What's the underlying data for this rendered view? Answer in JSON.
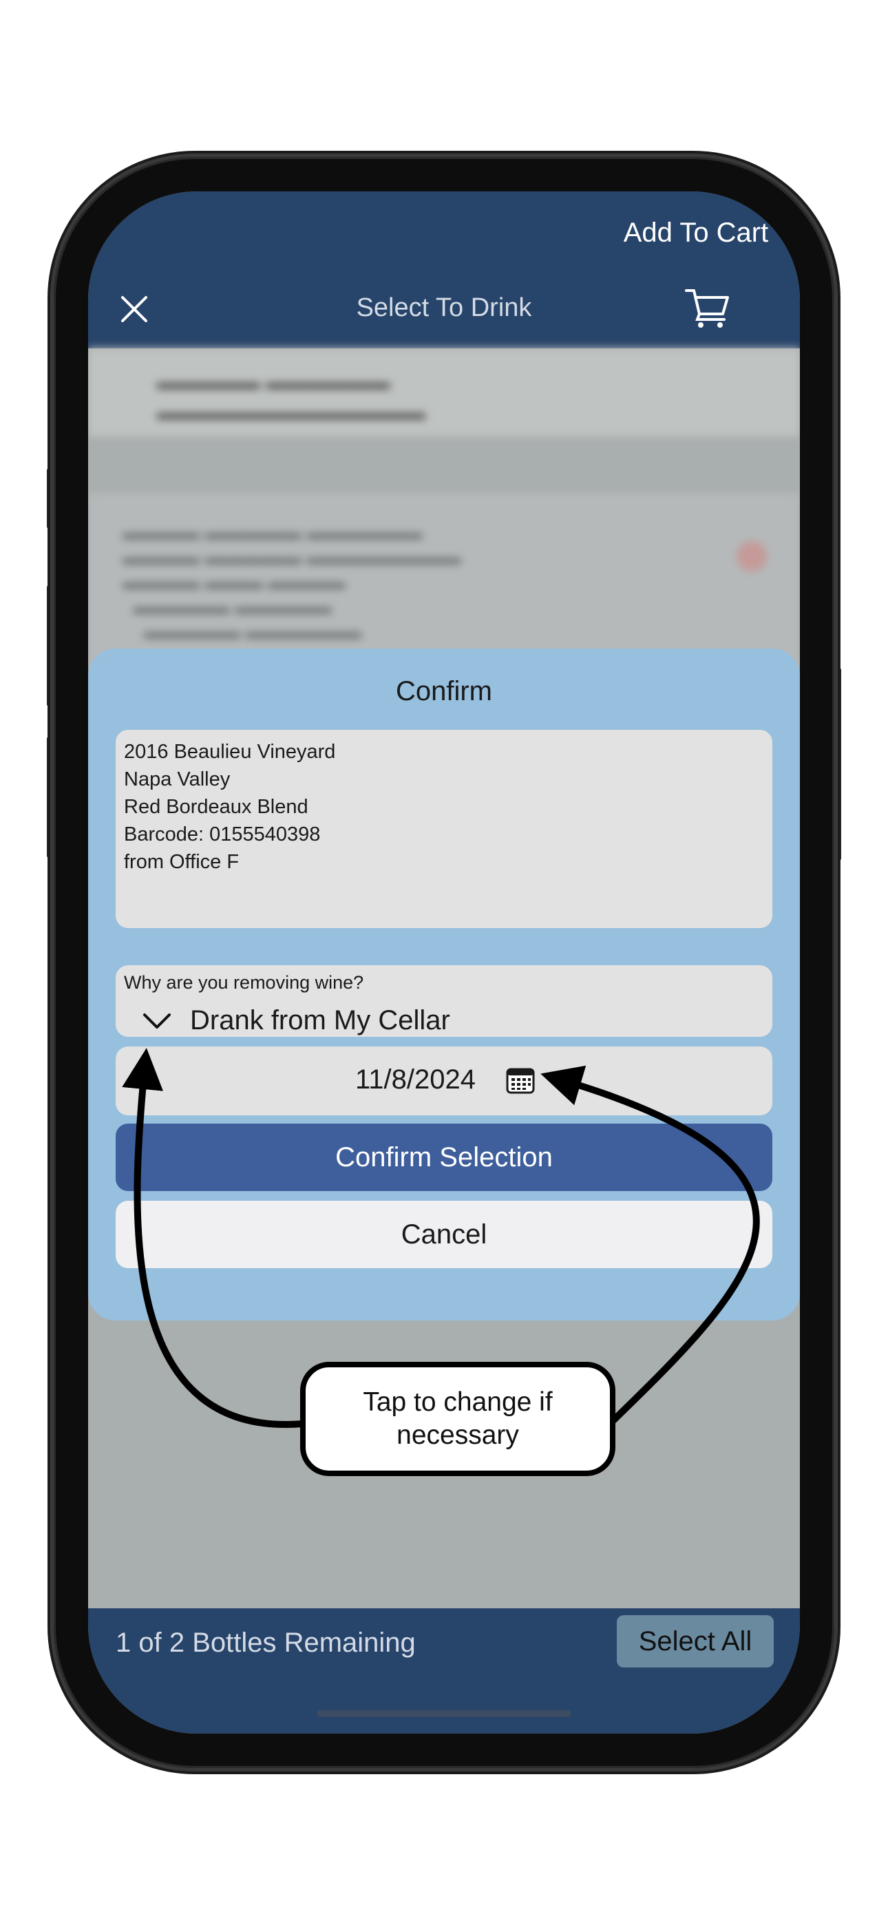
{
  "status_bar": {
    "signal_icon": "signal-dots-icon",
    "wifi_icon": "wifi-icon",
    "battery_icon": "battery-icon"
  },
  "nav": {
    "title": "Select To Drink",
    "close_icon": "close-icon",
    "cart_icon": "cart-icon"
  },
  "background_list": {
    "add_to_cart_label": "Add To Cart"
  },
  "dialog": {
    "title": "Confirm",
    "details": [
      "2016 Beaulieu Vineyard",
      "Napa Valley",
      "Red Bordeaux Blend",
      "Barcode: 0155540398",
      "from Office F"
    ],
    "reason_label": "Why are you removing wine?",
    "reason_value": "Drank from My Cellar",
    "date_value": "11/8/2024",
    "confirm_label": "Confirm Selection",
    "cancel_label": "Cancel"
  },
  "bottom_bar": {
    "remaining_text": "1 of 2 Bottles Remaining",
    "select_all_label": "Select All"
  },
  "annotation": {
    "callout_text": "Tap to change if necessary"
  },
  "colors": {
    "nav_bar": "#27446a",
    "dialog_bg": "#97bfde",
    "confirm_button": "#3f5f9c",
    "select_all_button": "#6a8aa0"
  }
}
